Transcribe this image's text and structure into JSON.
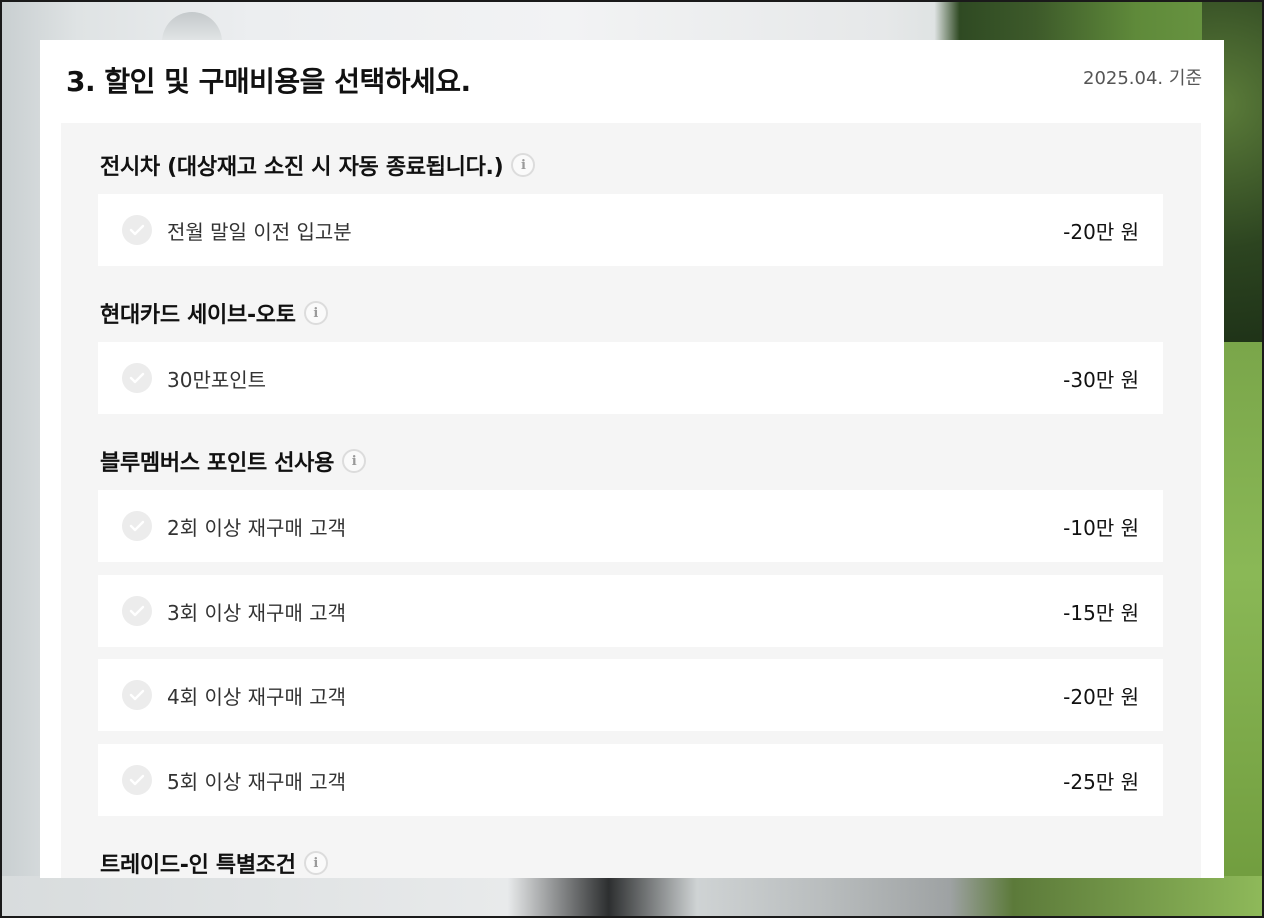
{
  "header": {
    "title": "3. 할인 및 구매비용을 선택하세요.",
    "as_of": "2025.04. 기준"
  },
  "sections": [
    {
      "title": "전시차 (대상재고 소진 시 자동 종료됩니다.)",
      "options": [
        {
          "label": "전월 말일 이전 입고분",
          "amount": "-20만 원"
        }
      ]
    },
    {
      "title": "현대카드 세이브-오토",
      "options": [
        {
          "label": "30만포인트",
          "amount": "-30만 원"
        }
      ]
    },
    {
      "title": "블루멤버스 포인트 선사용",
      "options": [
        {
          "label": "2회 이상 재구매 고객",
          "amount": "-10만 원"
        },
        {
          "label": "3회 이상 재구매 고객",
          "amount": "-15만 원"
        },
        {
          "label": "4회 이상 재구매 고객",
          "amount": "-20만 원"
        },
        {
          "label": "5회 이상 재구매 고객",
          "amount": "-25만 원"
        }
      ]
    },
    {
      "title": "트레이드-인 특별조건",
      "options": []
    }
  ],
  "icons": {
    "info": "info-icon",
    "check": "check-icon"
  },
  "colors": {
    "panel_bg": "#ffffff",
    "section_bg": "#f5f5f5",
    "check_bg": "#ececec"
  }
}
